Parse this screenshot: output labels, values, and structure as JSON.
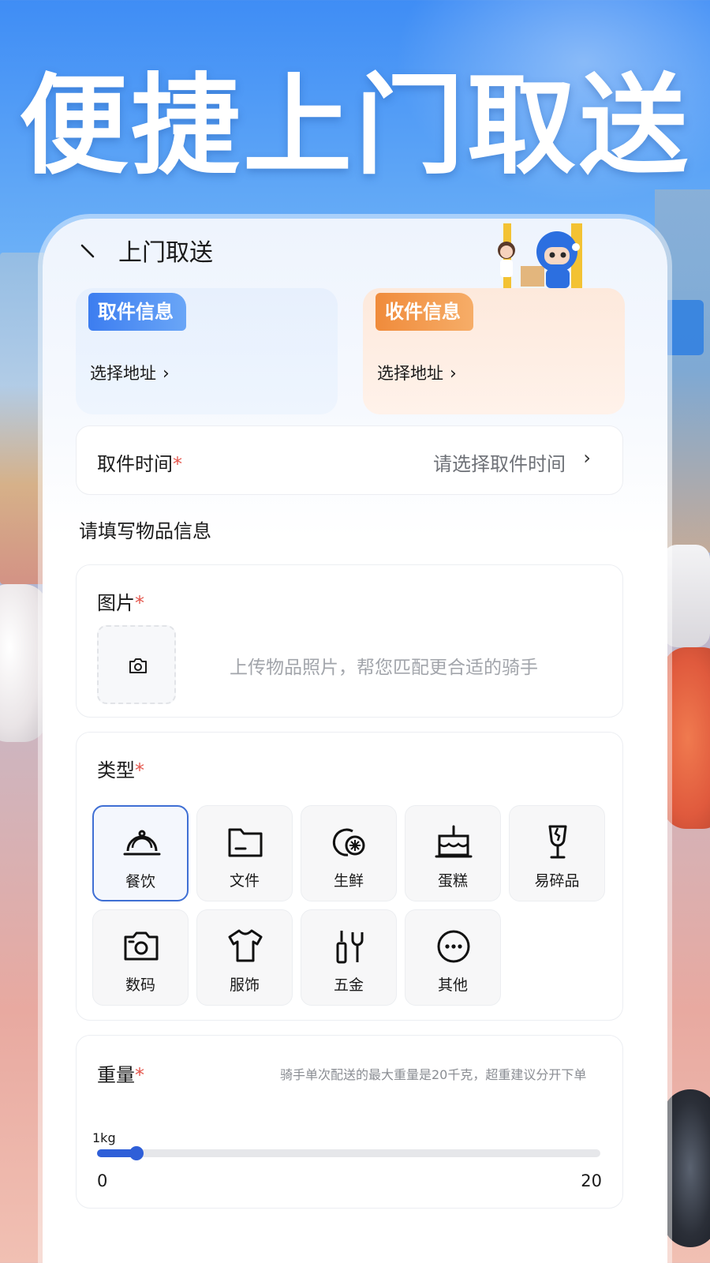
{
  "hero": {
    "title": "便捷上门取送"
  },
  "nav": {
    "title": "上门取送"
  },
  "address": {
    "pickup": {
      "tag": "取件信息",
      "select": "选择地址"
    },
    "receive": {
      "tag": "收件信息",
      "select": "选择地址"
    }
  },
  "pickup_time": {
    "label": "取件时间",
    "required": "*",
    "placeholder": "请选择取件时间"
  },
  "section": {
    "title": "请填写物品信息"
  },
  "photo": {
    "label": "图片",
    "required": "*",
    "hint": "上传物品照片，帮您匹配更合适的骑手"
  },
  "type": {
    "label": "类型",
    "required": "*",
    "selected": "餐饮",
    "items": [
      {
        "label": "餐饮",
        "icon": "cloche-icon"
      },
      {
        "label": "文件",
        "icon": "folder-icon"
      },
      {
        "label": "生鲜",
        "icon": "fresh-produce-icon"
      },
      {
        "label": "蛋糕",
        "icon": "cake-icon"
      },
      {
        "label": "易碎品",
        "icon": "fragile-glass-icon"
      },
      {
        "label": "数码",
        "icon": "camera-icon"
      },
      {
        "label": "服饰",
        "icon": "tshirt-icon"
      },
      {
        "label": "五金",
        "icon": "tools-icon"
      },
      {
        "label": "其他",
        "icon": "more-icon"
      }
    ]
  },
  "weight": {
    "label": "重量",
    "required": "*",
    "hint": "骑手单次配送的最大重量是20千克，超重建议分开下单",
    "current_label": "1kg",
    "value": 1,
    "min": 0,
    "max": 20,
    "min_label": "0",
    "max_label": "20"
  },
  "colors": {
    "accent": "#2f5fd8",
    "pickup_tag": "#3c7df0",
    "receive_tag": "#f08b3b",
    "required": "#e4584e"
  }
}
